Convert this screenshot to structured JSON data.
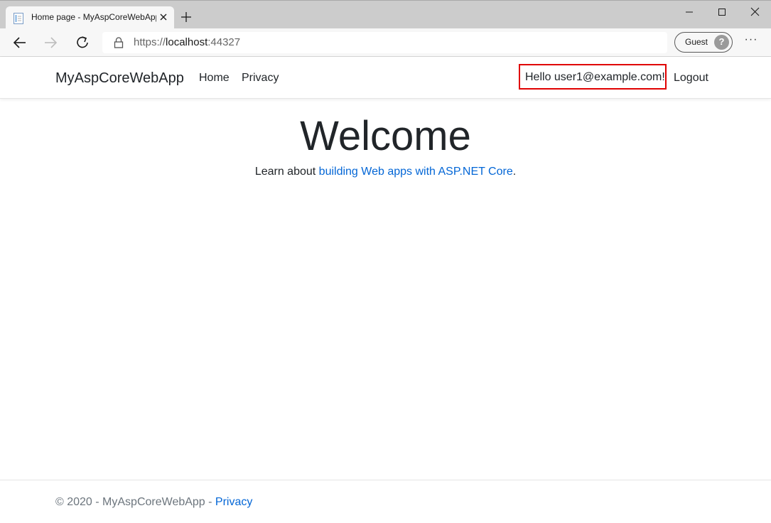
{
  "browser": {
    "tab_title": "Home page - MyAspCoreWebApp",
    "url_scheme": "https://",
    "url_host": "localhost",
    "url_port": ":44327",
    "profile_label": "Guest",
    "profile_glyph": "?",
    "more_label": "···",
    "icons": [
      "page-favicon-icon",
      "close-icon",
      "plus-icon",
      "minimize-icon",
      "maximize-icon",
      "close-window-icon",
      "back-arrow-icon",
      "forward-arrow-icon",
      "reload-icon",
      "lock-icon",
      "avatar-icon",
      "more-icon"
    ]
  },
  "site": {
    "brand": "MyAspCoreWebApp",
    "nav": {
      "home": "Home",
      "privacy": "Privacy"
    },
    "user": {
      "greeting": "Hello user1@example.com!",
      "logout": "Logout"
    },
    "highlight_color": "#e00000",
    "link_color": "#0366d6"
  },
  "main": {
    "title": "Welcome",
    "learn_prefix": "Learn about ",
    "learn_link": "building Web apps with ASP.NET Core",
    "learn_suffix": "."
  },
  "footer": {
    "text": "© 2020 - MyAspCoreWebApp - ",
    "privacy_link": "Privacy"
  }
}
